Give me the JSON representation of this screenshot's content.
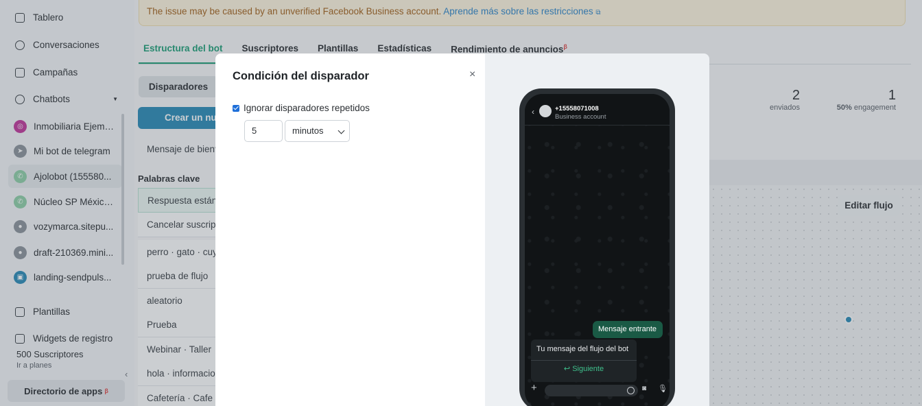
{
  "sidebar": {
    "nav": [
      {
        "label": "Tablero",
        "icon": "dashboard-icon"
      },
      {
        "label": "Conversaciones",
        "icon": "chat-icon"
      },
      {
        "label": "Campañas",
        "icon": "campaign-icon"
      },
      {
        "label": "Chatbots",
        "icon": "chatbot-icon"
      }
    ],
    "bots": [
      {
        "label": "Inmobiliaria Ejemp...",
        "icon": "instagram-icon",
        "color": "#c2379c"
      },
      {
        "label": "Mi bot de telegram",
        "icon": "telegram-icon",
        "color": "#8d949b"
      },
      {
        "label": "Ajolobot (155580...",
        "icon": "whatsapp-icon",
        "color": "#8fd0a8"
      },
      {
        "label": "Núcleo SP México...",
        "icon": "whatsapp-icon",
        "color": "#8fd0a8"
      },
      {
        "label": "vozymarca.sitepu...",
        "icon": "site-icon",
        "color": "#8d949b"
      },
      {
        "label": "draft-210369.mini...",
        "icon": "site-icon",
        "color": "#8d949b"
      },
      {
        "label": "landing-sendpuls...",
        "icon": "chat-widget-icon",
        "color": "#2a8bb8"
      }
    ],
    "bottom_nav": [
      {
        "label": "Plantillas",
        "icon": "templates-icon"
      },
      {
        "label": "Widgets de registro",
        "icon": "widget-icon"
      }
    ],
    "subscribers": "500 Suscriptores",
    "plans_link": "Ir a planes",
    "directory_label": "Directorio de apps",
    "beta": "β"
  },
  "main": {
    "warning_text": "The issue may be caused by an unverified Facebook Business account.",
    "warning_link": "Aprende más sobre las restricciones",
    "tabs": [
      "Estructura del bot",
      "Suscriptores",
      "Plantillas",
      "Estadísticas",
      "Rendimiento de anuncios"
    ],
    "triggers_label": "Disparadores",
    "create_label": "Crear un nue",
    "welcome_label": "Mensaje de bienv",
    "keywords_title": "Palabras clave",
    "keywords": [
      "Respuesta están",
      "Cancelar suscrip",
      "perro · gato · cuy",
      "prueba de flujo",
      "aleatorio",
      "Prueba",
      "Webinar · Taller",
      "hola · informacio",
      "Cafetería · Cafe"
    ],
    "stats": [
      {
        "value": "2",
        "label": "enviados"
      },
      {
        "value": "1",
        "label_bold": "50%",
        "label": "engagement"
      }
    ],
    "edit_flow": "Editar flujo"
  },
  "modal": {
    "title": "Condición del disparador",
    "checkbox_label": "Ignorar disparadores repetidos",
    "checkbox_checked": true,
    "number_value": "5",
    "unit_value": "minutos",
    "close": "×",
    "preview": {
      "phone_number": "+15558071008",
      "account_type": "Business account",
      "incoming": "Mensaje entrante",
      "outgoing": "Tu mensaje del flujo del bot",
      "button": "Siguiente"
    }
  }
}
